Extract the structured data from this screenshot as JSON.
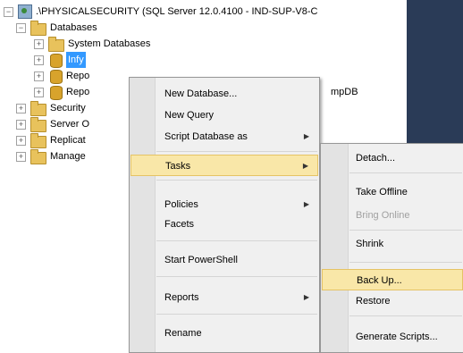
{
  "tree": {
    "server_label": ".\\PHYSICALSECURITY (SQL Server 12.0.4100 - IND-SUP-V8-C",
    "databases_label": "Databases",
    "system_databases_label": "System Databases",
    "selected_db_label": "Infy",
    "rep_1_label": "Repo",
    "rep_2_label": "Repo",
    "security_label": "Security",
    "server_objects_label": "Server O",
    "replication_label": "Replicat",
    "management_label": "Manage",
    "partial_db_label": "mpDB"
  },
  "context_menu": {
    "new_database": "New Database...",
    "new_query": "New Query",
    "script_database_as": "Script Database as",
    "tasks": "Tasks",
    "policies": "Policies",
    "facets": "Facets",
    "start_powershell": "Start PowerShell",
    "reports": "Reports",
    "rename": "Rename",
    "submenu_arrow": "▶"
  },
  "tasks_submenu": {
    "detach": "Detach...",
    "take_offline": "Take Offline",
    "bring_online": "Bring Online",
    "shrink": "Shrink",
    "back_up": "Back Up...",
    "restore": "Restore",
    "generate_scripts": "Generate Scripts..."
  },
  "icons": {
    "expand_minus": "−",
    "expand_plus": "+"
  },
  "colors": {
    "selection": "#3399ff",
    "highlight": "#f9e7a8",
    "dark_pane": "#2a3b57"
  }
}
